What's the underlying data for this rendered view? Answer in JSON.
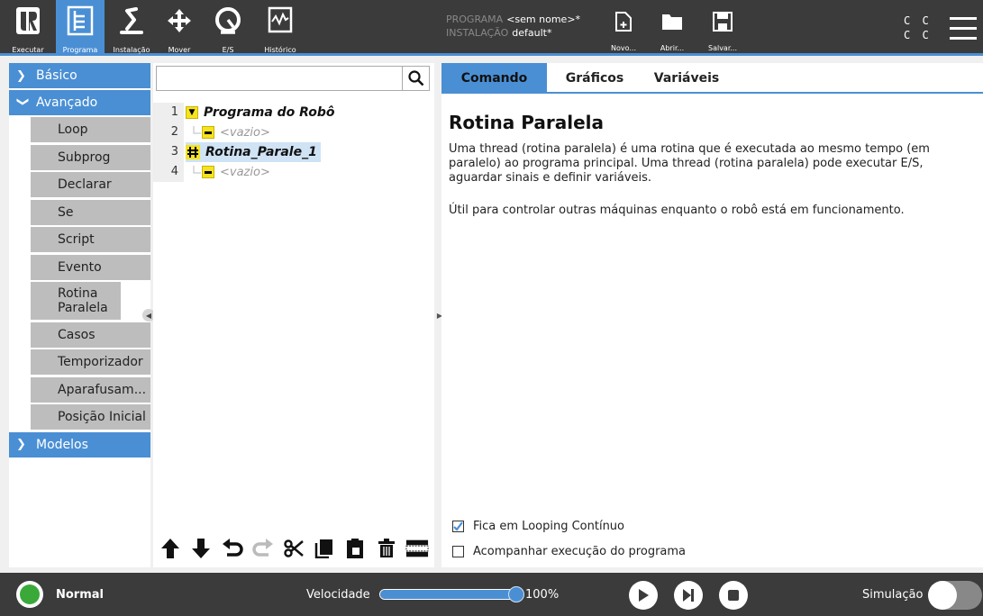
{
  "topbar": {
    "nav": [
      {
        "label": "Executar",
        "icon": "ur-logo-icon"
      },
      {
        "label": "Programa",
        "icon": "program-tree-icon"
      },
      {
        "label": "Instalação",
        "icon": "installation-arm-icon"
      },
      {
        "label": "Mover",
        "icon": "move-arrows-icon"
      },
      {
        "label": "E/S",
        "icon": "io-gauge-icon"
      },
      {
        "label": "Histórico",
        "icon": "log-waveform-icon"
      }
    ],
    "program_label": "PROGRAMA",
    "program_value": "<sem nome>*",
    "installation_label": "INSTALAÇÃO",
    "installation_value": "default*",
    "file_buttons": [
      {
        "label": "Novo...",
        "icon": "new-file-icon"
      },
      {
        "label": "Abrir...",
        "icon": "folder-icon"
      },
      {
        "label": "Salvar...",
        "icon": "save-icon"
      }
    ],
    "cc_line1": "C C",
    "cc_line2": "C C",
    "accent": "#4a8fd4"
  },
  "sidebar": {
    "basic": "Básico",
    "advanced": "Avançado",
    "items": [
      "Loop",
      "Subprog",
      "Declarar",
      "Se",
      "Script",
      "Evento",
      "Rotina Paralela",
      "Casos",
      "Temporizador",
      "Aparafusam...",
      "Posição Inicial"
    ],
    "models": "Modelos"
  },
  "tree": {
    "rows": [
      {
        "num": "1",
        "text": "Programa do Robô"
      },
      {
        "num": "2",
        "text": "<vazio>"
      },
      {
        "num": "3",
        "text": "Rotina_Parale_1"
      },
      {
        "num": "4",
        "text": "<vazio>"
      }
    ]
  },
  "right": {
    "tabs": [
      "Comando",
      "Gráficos",
      "Variáveis"
    ],
    "title": "Rotina Paralela",
    "description": "Uma thread (rotina paralela) é uma rotina que é executada ao mesmo tempo (em paralelo) ao programa principal. Uma thread (rotina paralela) pode executar E/S, aguardar sinais e definir variáveis.",
    "description2": "Útil para controlar outras máquinas enquanto o robô está em funcionamento.",
    "checkbox1": "Fica em Looping Contínuo",
    "checkbox1_checked": true,
    "checkbox2": "Acompanhar execução do programa",
    "checkbox2_checked": false
  },
  "bottombar": {
    "status": "Normal",
    "speed_label": "Velocidade",
    "speed_value": "100%",
    "speed_fraction": 1.0,
    "sim_label": "Simulação",
    "status_color": "#3aa93a"
  }
}
